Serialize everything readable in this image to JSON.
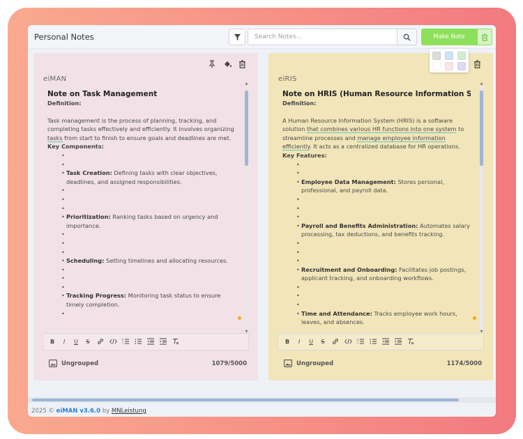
{
  "header": {
    "title": "Personal Notes",
    "search_placeholder": "Search Notes...",
    "make_note_label": "Make Note"
  },
  "notes": [
    {
      "author": "eiMAN",
      "title": "Note on Task Management",
      "definition_label": "Definition:",
      "definition_text_parts": [
        "Task management is the process of planning, tracking, and completing tasks effectively and efficiently. It involves organizing ",
        "tasks",
        " from start to finish to ensure goals and deadlines are met."
      ],
      "key_label": "Key Components:",
      "items": [
        {
          "term": "Task Creation:",
          "text": " Defining tasks with clear objectives, deadlines, and assigned responsibilities."
        },
        {
          "term": "Prioritization:",
          "text": " Ranking tasks based on urgency and importance."
        },
        {
          "term": "Scheduling:",
          "text": " Setting timelines and allocating resources."
        },
        {
          "term": "Tracking Progress:",
          "text": " Monitoring task status to ensure timely completion."
        }
      ],
      "group": "Ungrouped",
      "count": "1079/5000",
      "bg_color": "#f2e1e6"
    },
    {
      "author": "eiRIS",
      "title": "Note on HRIS (Human Resource Information Syst",
      "definition_label": "Definition:",
      "definition_text_parts": [
        "A Human Resource Information System (HRIS) is a software solution ",
        "that combines various HR functions into one system",
        " to streamline processes and ",
        "manage employee information efficiently",
        ". It acts as a centralized database for HR operations."
      ],
      "key_label": "Key Features:",
      "items": [
        {
          "term": "Employee Data Management:",
          "text": " Stores personal, professional, and payroll data."
        },
        {
          "term": "Payroll and Benefits Administration:",
          "text": " Automates salary processing, tax deductions, and benefits tracking."
        },
        {
          "term": "Recruitment and Onboarding:",
          "text": " Facilitates job postings, applicant tracking, and onboarding workflows."
        },
        {
          "term": "Time and Attendance:",
          "text": " Tracks employee work hours, leaves, and absences."
        }
      ],
      "group": "Ungrouped",
      "count": "1174/5000",
      "bg_color": "#f1e5b9"
    }
  ],
  "toolbar_buttons": [
    "B",
    "I",
    "U",
    "S"
  ],
  "palette_colors": [
    "#dcdcdc",
    "#cfe2f7",
    "#d3ecd6",
    "#ffffff",
    "#fde6e8",
    "#e2d9f3"
  ],
  "footer": {
    "year": "2025 ©",
    "brand": "eiMAN v3.6.0",
    "by": "by",
    "credit": "MNLeistung"
  },
  "colors": {
    "accent_green": "#8ee05b",
    "brand_blue": "#2b7fd8"
  }
}
